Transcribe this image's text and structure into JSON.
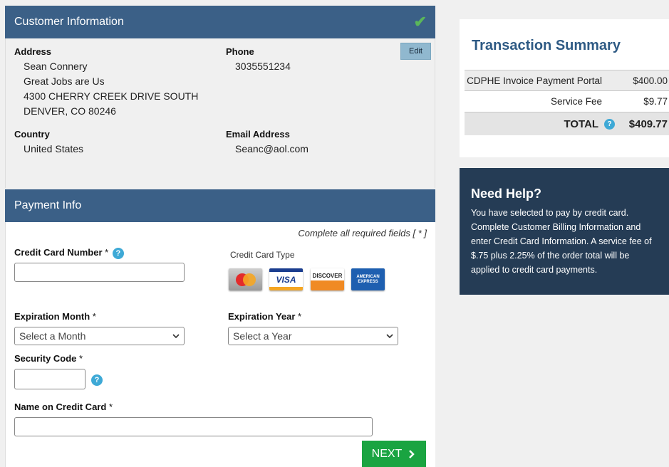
{
  "customer": {
    "title": "Customer Information",
    "edit_label": "Edit",
    "address_label": "Address",
    "address_lines": [
      "Sean Connery",
      "Great Jobs are Us",
      "4300 CHERRY CREEK DRIVE SOUTH",
      "DENVER, CO 80246"
    ],
    "phone_label": "Phone",
    "phone": "3035551234",
    "country_label": "Country",
    "country": "United States",
    "email_label": "Email Address",
    "email": "Seanc@aol.com"
  },
  "payment": {
    "title": "Payment Info",
    "required_note": "Complete all required fields [ * ]",
    "cc_number_label": "Credit Card Number",
    "cc_type_label": "Credit Card Type",
    "cards": [
      "MasterCard",
      "VISA",
      "DISCOVER",
      "AMERICAN EXPRESS"
    ],
    "exp_month_label": "Expiration Month",
    "exp_month_value": "Select a Month",
    "exp_year_label": "Expiration Year",
    "exp_year_value": "Select a Year",
    "security_label": "Security Code",
    "name_label": "Name on Credit Card",
    "required_star": "*",
    "help_glyph": "?",
    "next_label": "NEXT"
  },
  "summary": {
    "title": "Transaction Summary",
    "rows": [
      {
        "desc": "CDPHE Invoice Payment Portal",
        "amount": "$400.00"
      },
      {
        "desc": "Service Fee",
        "amount": "$9.77"
      }
    ],
    "total_label": "TOTAL",
    "total_amount": "$409.77"
  },
  "help": {
    "title": "Need Help?",
    "text": "You have selected to pay by credit card. Complete Customer Billing Information and enter Credit Card Information. A service fee of $.75 plus 2.25% of the order total will be applied to credit card payments."
  },
  "colors": {
    "header_blue": "#3b6087",
    "next_green": "#1aa441",
    "help_navy": "#253c55",
    "title_blue": "#2e5a84"
  },
  "icons": [
    "checkmark-icon",
    "help-icon",
    "chevron-down-icon",
    "chevron-right-icon"
  ]
}
